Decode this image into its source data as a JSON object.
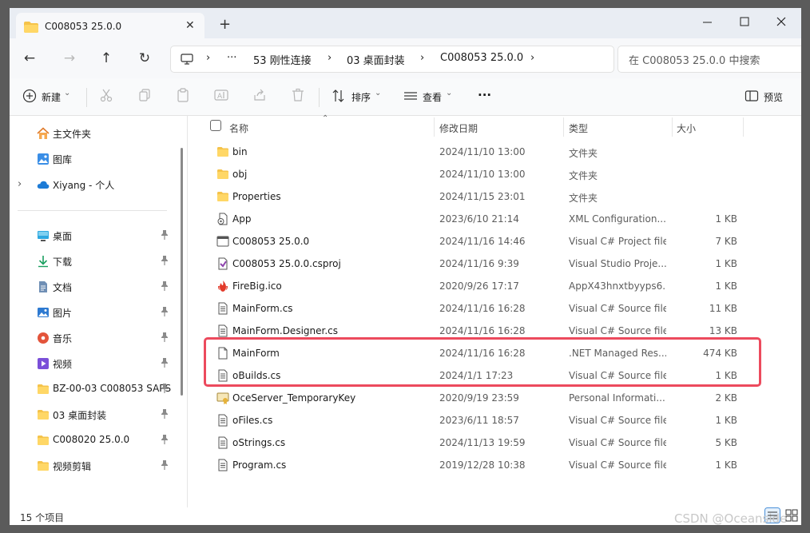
{
  "window": {
    "tab_title": "C008053 25.0.0",
    "close_glyph": "✕",
    "new_tab_glyph": "+",
    "controls": {
      "minimize": "–",
      "maximize": "☐",
      "close": "✕"
    }
  },
  "navigation": {
    "back": "←",
    "forward": "→",
    "up": "↑",
    "refresh": "↻",
    "more": "···",
    "breadcrumb": [
      "53 刚性连接",
      "03 桌面封装",
      "C008053 25.0.0"
    ],
    "chevron": "›",
    "search_placeholder": "在 C008053 25.0.0 中搜索"
  },
  "toolbar": {
    "new_label": "新建",
    "sort_label": "排序",
    "view_label": "查看",
    "more_label": "···",
    "preview_label": "预览",
    "caret": "⌄"
  },
  "sidebar": {
    "expand_glyph": "›",
    "pin_glyph": "📌",
    "group1": [
      {
        "label": "主文件夹",
        "icon": "home-icon"
      },
      {
        "label": "图库",
        "icon": "gallery-icon"
      },
      {
        "label": "Xiyang - 个人",
        "icon": "cloud-icon"
      }
    ],
    "group2": [
      {
        "label": "桌面",
        "icon": "desktop-icon"
      },
      {
        "label": "下载",
        "icon": "download-icon"
      },
      {
        "label": "文档",
        "icon": "document-icon"
      },
      {
        "label": "图片",
        "icon": "pictures-icon"
      },
      {
        "label": "音乐",
        "icon": "music-icon"
      },
      {
        "label": "视频",
        "icon": "video-icon"
      },
      {
        "label": "BZ-00-03 C008053 SAPS",
        "icon": "folder-icon"
      },
      {
        "label": "03 桌面封装",
        "icon": "folder-icon"
      },
      {
        "label": "C008020 25.0.0",
        "icon": "folder-icon"
      },
      {
        "label": "视频剪辑",
        "icon": "folder-icon"
      }
    ]
  },
  "file_list": {
    "columns": [
      "名称",
      "修改日期",
      "类型",
      "大小"
    ],
    "rows": [
      {
        "name": "bin",
        "date": "2024/11/10 13:00",
        "type": "文件夹",
        "size": "",
        "icon": "folder"
      },
      {
        "name": "obj",
        "date": "2024/11/10 13:00",
        "type": "文件夹",
        "size": "",
        "icon": "folder"
      },
      {
        "name": "Properties",
        "date": "2024/11/15 23:01",
        "type": "文件夹",
        "size": "",
        "icon": "folder"
      },
      {
        "name": "App",
        "date": "2023/6/10 21:14",
        "type": "XML Configuration...",
        "size": "1 KB",
        "icon": "config"
      },
      {
        "name": "C008053 25.0.0",
        "date": "2024/11/16 14:46",
        "type": "Visual C# Project file",
        "size": "7 KB",
        "icon": "project"
      },
      {
        "name": "C008053 25.0.0.csproj",
        "date": "2024/11/16 9:39",
        "type": "Visual Studio Proje...",
        "size": "1 KB",
        "icon": "vs"
      },
      {
        "name": "FireBig.ico",
        "date": "2020/9/26 17:17",
        "type": "AppX43hnxtbyyps6...",
        "size": "1 KB",
        "icon": "fire"
      },
      {
        "name": "MainForm.cs",
        "date": "2024/11/16 16:28",
        "type": "Visual C# Source file",
        "size": "11 KB",
        "icon": "code"
      },
      {
        "name": "MainForm.Designer.cs",
        "date": "2024/11/16 16:28",
        "type": "Visual C# Source file",
        "size": "13 KB",
        "icon": "code"
      },
      {
        "name": "MainForm",
        "date": "2024/11/16 16:28",
        "type": ".NET Managed Res...",
        "size": "474 KB",
        "icon": "resource"
      },
      {
        "name": "oBuilds.cs",
        "date": "2024/1/1 17:23",
        "type": "Visual C# Source file",
        "size": "1 KB",
        "icon": "code"
      },
      {
        "name": "OceServer_TemporaryKey",
        "date": "2020/9/19 23:59",
        "type": "Personal Informati...",
        "size": "2 KB",
        "icon": "cert"
      },
      {
        "name": "oFiles.cs",
        "date": "2023/6/11 18:57",
        "type": "Visual C# Source file",
        "size": "1 KB",
        "icon": "code"
      },
      {
        "name": "oStrings.cs",
        "date": "2024/11/13 19:59",
        "type": "Visual C# Source file",
        "size": "5 KB",
        "icon": "code"
      },
      {
        "name": "Program.cs",
        "date": "2019/12/28 10:38",
        "type": "Visual C# Source file",
        "size": "1 KB",
        "icon": "code"
      }
    ]
  },
  "status": {
    "item_count": "15 个项目"
  },
  "watermark": "CSDN @Oceanside",
  "colors": {
    "highlight": "#ec4a5d",
    "folder": "#f5c34a",
    "accent": "#0067c0"
  }
}
